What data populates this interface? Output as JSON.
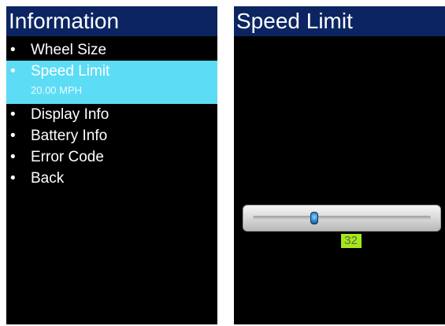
{
  "left_screen": {
    "title": "Information",
    "menu": [
      {
        "label": "Wheel Size",
        "bullet": "•"
      },
      {
        "label": "Speed Limit",
        "bullet": "•",
        "selected": true,
        "value": "20.00 MPH"
      },
      {
        "label": "Display Info",
        "bullet": "•"
      },
      {
        "label": "Battery Info",
        "bullet": "•"
      },
      {
        "label": "Error Code",
        "bullet": "•"
      },
      {
        "label": "Back",
        "bullet": "•"
      }
    ]
  },
  "right_screen": {
    "title": "Speed Limit",
    "slider": {
      "value": "32",
      "position_fraction": 0.34
    }
  },
  "colors": {
    "header": "#0c2562",
    "screen_background": "#000000",
    "selection": "#5ddcf5",
    "value_badge": "#a6e71d"
  }
}
